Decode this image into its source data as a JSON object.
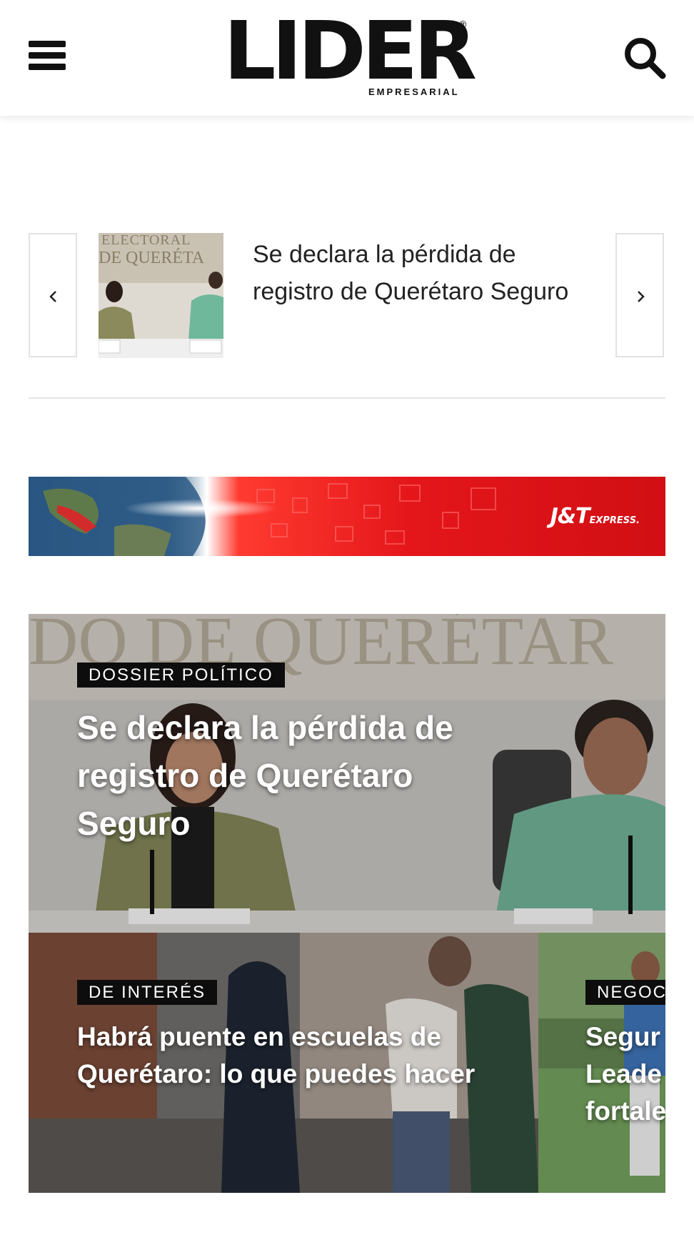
{
  "header": {
    "logo_text": "LIDER",
    "logo_subtext": "EMPRESARIAL",
    "logo_registered": "®",
    "menu_icon": "hamburger-menu-icon",
    "search_icon": "search-icon"
  },
  "slider": {
    "title": "Se declara la pérdida de registro de Querétaro Seguro",
    "thumb_sign_text": "ELECTORAL DE QUERÉTARO",
    "prev_icon": "chevron-left-icon",
    "next_icon": "chevron-right-icon"
  },
  "ad": {
    "brand": "J&T",
    "brand_suffix": "EXPRESS."
  },
  "featured": {
    "category": "DOSSIER POLÍTICO",
    "title": "Se declara la pérdida de registro de Querétaro Seguro",
    "background_text": "DO DE QUERÉTAR"
  },
  "cards": [
    {
      "category": "DE INTERÉS",
      "title": "Habrá puente en escuelas de Querétaro: lo que puedes hacer"
    },
    {
      "category": "NEGOC",
      "title": "Segur\nLeade\nfortale"
    }
  ],
  "colors": {
    "ad_red": "#e4161a",
    "badge_bg": "#0d0d0d",
    "logo": "#111111"
  }
}
